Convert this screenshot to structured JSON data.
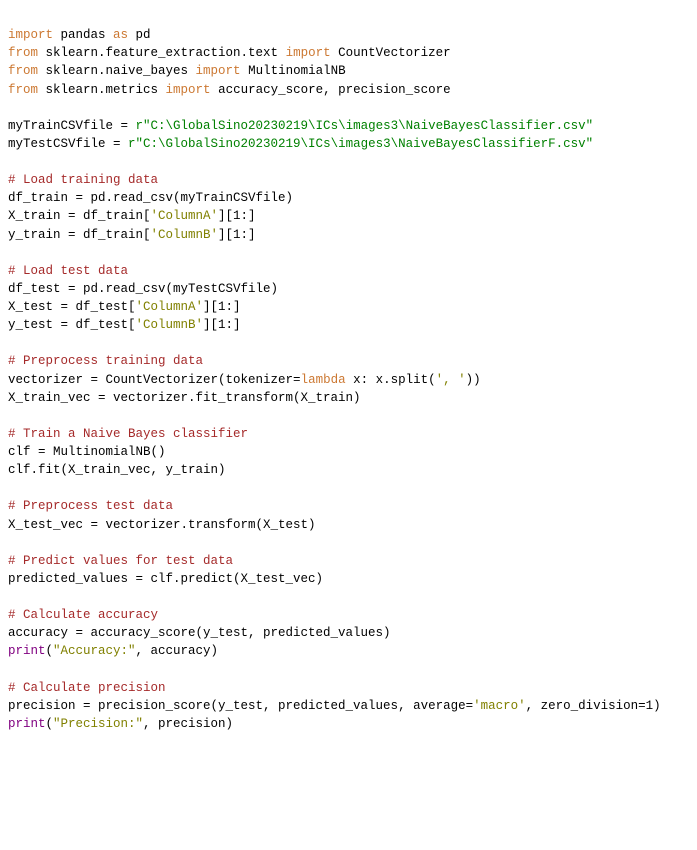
{
  "code_lines": [
    [
      [
        "orange",
        "import"
      ],
      [
        "black",
        " pandas "
      ],
      [
        "orange",
        "as"
      ],
      [
        "black",
        " pd"
      ]
    ],
    [
      [
        "orange",
        "from"
      ],
      [
        "black",
        " sklearn.feature_extraction.text "
      ],
      [
        "orange",
        "import"
      ],
      [
        "black",
        " CountVectorizer"
      ]
    ],
    [
      [
        "orange",
        "from"
      ],
      [
        "black",
        " sklearn.naive_bayes "
      ],
      [
        "orange",
        "import"
      ],
      [
        "black",
        " MultinomialNB"
      ]
    ],
    [
      [
        "orange",
        "from"
      ],
      [
        "black",
        " sklearn.metrics "
      ],
      [
        "orange",
        "import"
      ],
      [
        "black",
        " accuracy_score, precision_score"
      ]
    ],
    [],
    [
      [
        "black",
        "myTrainCSVfile = "
      ],
      [
        "green",
        "r\"C:\\GlobalSino20230219\\ICs\\images3\\NaiveBayesClassifier.csv\""
      ]
    ],
    [
      [
        "black",
        "myTestCSVfile = "
      ],
      [
        "green",
        "r\"C:\\GlobalSino20230219\\ICs\\images3\\NaiveBayesClassifierF.csv\""
      ]
    ],
    [],
    [
      [
        "darkred",
        "# Load training data"
      ]
    ],
    [
      [
        "black",
        "df_train = pd.read_csv(myTrainCSVfile)"
      ]
    ],
    [
      [
        "black",
        "X_train = df_train["
      ],
      [
        "olive",
        "'ColumnA'"
      ],
      [
        "black",
        "][1:]"
      ]
    ],
    [
      [
        "black",
        "y_train = df_train["
      ],
      [
        "olive",
        "'ColumnB'"
      ],
      [
        "black",
        "][1:]"
      ]
    ],
    [],
    [
      [
        "darkred",
        "# Load test data"
      ]
    ],
    [
      [
        "black",
        "df_test = pd.read_csv(myTestCSVfile)"
      ]
    ],
    [
      [
        "black",
        "X_test = df_test["
      ],
      [
        "olive",
        "'ColumnA'"
      ],
      [
        "black",
        "][1:]"
      ]
    ],
    [
      [
        "black",
        "y_test = df_test["
      ],
      [
        "olive",
        "'ColumnB'"
      ],
      [
        "black",
        "][1:]"
      ]
    ],
    [],
    [
      [
        "darkred",
        "# Preprocess training data"
      ]
    ],
    [
      [
        "black",
        "vectorizer = CountVectorizer(tokenizer="
      ],
      [
        "orange",
        "lambda"
      ],
      [
        "black",
        " x: x.split("
      ],
      [
        "olive",
        "', '"
      ],
      [
        "black",
        "))"
      ]
    ],
    [
      [
        "black",
        "X_train_vec = vectorizer.fit_transform(X_train)"
      ]
    ],
    [],
    [
      [
        "darkred",
        "# Train a Naive Bayes classifier"
      ]
    ],
    [
      [
        "black",
        "clf = MultinomialNB()"
      ]
    ],
    [
      [
        "black",
        "clf.fit(X_train_vec, y_train)"
      ]
    ],
    [],
    [
      [
        "darkred",
        "# Preprocess test data"
      ]
    ],
    [
      [
        "black",
        "X_test_vec = vectorizer.transform(X_test)"
      ]
    ],
    [],
    [
      [
        "darkred",
        "# Predict values for test data"
      ]
    ],
    [
      [
        "black",
        "predicted_values = clf.predict(X_test_vec)"
      ]
    ],
    [],
    [
      [
        "darkred",
        "# Calculate accuracy"
      ]
    ],
    [
      [
        "black",
        "accuracy = accuracy_score(y_test, predicted_values)"
      ]
    ],
    [
      [
        "purple",
        "print"
      ],
      [
        "black",
        "("
      ],
      [
        "olive",
        "\"Accuracy:\""
      ],
      [
        "black",
        ", accuracy)"
      ]
    ],
    [],
    [
      [
        "darkred",
        "# Calculate precision"
      ]
    ],
    [
      [
        "black",
        "precision = precision_score(y_test, predicted_values, average="
      ],
      [
        "olive",
        "'macro'"
      ],
      [
        "black",
        ", zero_division=1)"
      ]
    ],
    [
      [
        "purple",
        "print"
      ],
      [
        "black",
        "("
      ],
      [
        "olive",
        "\"Precision:\""
      ],
      [
        "black",
        ", precision)"
      ]
    ]
  ]
}
